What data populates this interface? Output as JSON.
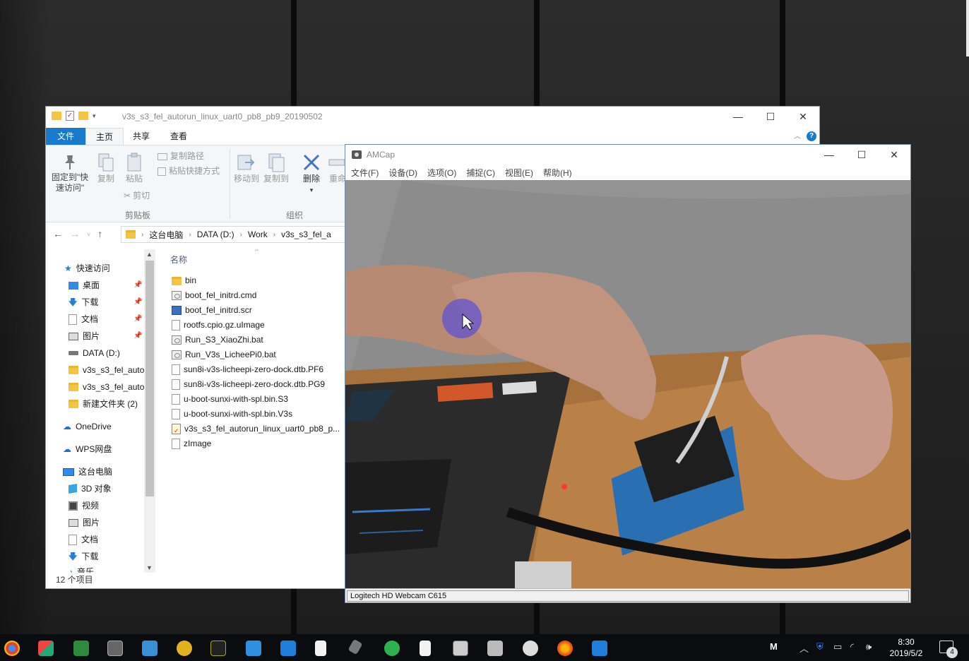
{
  "explorer": {
    "title": "v3s_s3_fel_autorun_linux_uart0_pb8_pb9_20190502",
    "tabs": {
      "file": "文件",
      "home": "主页",
      "share": "共享",
      "view": "查看"
    },
    "ribbon": {
      "pin_line1": "固定到\"快",
      "pin_line2": "速访问\"",
      "copy": "复制",
      "paste": "粘贴",
      "copy_path": "复制路径",
      "paste_shortcut": "粘贴快捷方式",
      "cut": "剪切",
      "clipboard_group": "剪贴板",
      "move_to": "移动到",
      "copy_to": "复制到",
      "delete": "删除",
      "rename": "重命",
      "organize_group": "组织"
    },
    "address": {
      "crumbs": [
        "这台电脑",
        "DATA (D:)",
        "Work",
        "v3s_s3_fel_a"
      ]
    },
    "nav": {
      "quick_access": "快速访问",
      "desktop": "桌面",
      "downloads": "下载",
      "documents": "文档",
      "pictures": "图片",
      "data_drive": "DATA (D:)",
      "folder1": "v3s_s3_fel_auto",
      "folder2": "v3s_s3_fel_auto",
      "new_folder": "新建文件夹 (2)",
      "onedrive": "OneDrive",
      "wps": "WPS网盘",
      "this_pc": "这台电脑",
      "objects3d": "3D 对象",
      "videos": "视频",
      "pictures2": "图片",
      "documents2": "文档",
      "downloads2": "下载",
      "music": "音乐"
    },
    "column_name": "名称",
    "files": [
      {
        "name": "bin",
        "icon": "folder-icon"
      },
      {
        "name": "boot_fel_initrd.cmd",
        "icon": "cmd-file-icon"
      },
      {
        "name": "boot_fel_initrd.scr",
        "icon": "scr-file-icon"
      },
      {
        "name": "rootfs.cpio.gz.uImage",
        "icon": "file-icon"
      },
      {
        "name": "Run_S3_XiaoZhi.bat",
        "icon": "bat-file-icon"
      },
      {
        "name": "Run_V3s_LicheePi0.bat",
        "icon": "bat-file-icon"
      },
      {
        "name": "sun8i-v3s-licheepi-zero-dock.dtb.PF6",
        "icon": "file-icon"
      },
      {
        "name": "sun8i-v3s-licheepi-zero-dock.dtb.PG9",
        "icon": "file-icon"
      },
      {
        "name": "u-boot-sunxi-with-spl.bin.S3",
        "icon": "file-icon"
      },
      {
        "name": "u-boot-sunxi-with-spl.bin.V3s",
        "icon": "file-icon"
      },
      {
        "name": "v3s_s3_fel_autorun_linux_uart0_pb8_p...",
        "icon": "archive-icon"
      },
      {
        "name": "zImage",
        "icon": "file-icon"
      }
    ],
    "status": "12 个项目"
  },
  "amcap": {
    "title": "AMCap",
    "menu": [
      "文件(F)",
      "设备(D)",
      "选项(O)",
      "捕捉(C)",
      "视图(E)",
      "帮助(H)"
    ],
    "status": "Logitech HD Webcam C615"
  },
  "taskbar": {
    "time": "8:30",
    "date": "2019/5/2",
    "notification_count": "4",
    "tray_m": "M"
  },
  "colors": {
    "accent": "#1979ca",
    "taskbar": "#0a0c10"
  }
}
